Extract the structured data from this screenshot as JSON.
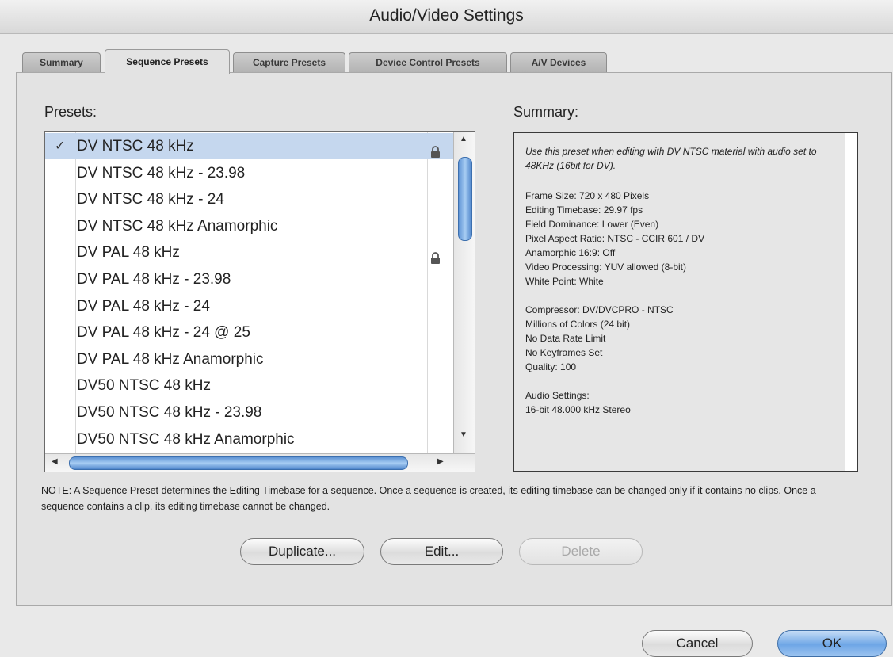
{
  "window": {
    "title": "Audio/Video Settings"
  },
  "tabs": [
    {
      "label": "Summary",
      "active": false
    },
    {
      "label": "Sequence Presets",
      "active": true
    },
    {
      "label": "Capture Presets",
      "active": false
    },
    {
      "label": "Device Control Presets",
      "active": false
    },
    {
      "label": "A/V Devices",
      "active": false
    }
  ],
  "presets": {
    "label": "Presets:",
    "check_glyph": "✓",
    "items": [
      {
        "label": "DV NTSC 48 kHz",
        "selected": true,
        "checked": true,
        "locked": true
      },
      {
        "label": "DV NTSC 48 kHz - 23.98",
        "selected": false,
        "checked": false,
        "locked": false
      },
      {
        "label": "DV NTSC 48 kHz - 24",
        "selected": false,
        "checked": false,
        "locked": false
      },
      {
        "label": "DV NTSC 48 kHz Anamorphic",
        "selected": false,
        "checked": false,
        "locked": false
      },
      {
        "label": "DV PAL 48 kHz",
        "selected": false,
        "checked": false,
        "locked": true
      },
      {
        "label": "DV PAL 48 kHz - 23.98",
        "selected": false,
        "checked": false,
        "locked": false
      },
      {
        "label": "DV PAL 48 kHz - 24",
        "selected": false,
        "checked": false,
        "locked": false
      },
      {
        "label": "DV PAL 48 kHz - 24 @ 25",
        "selected": false,
        "checked": false,
        "locked": false
      },
      {
        "label": "DV PAL 48 kHz Anamorphic",
        "selected": false,
        "checked": false,
        "locked": false
      },
      {
        "label": "DV50 NTSC 48 kHz",
        "selected": false,
        "checked": false,
        "locked": false
      },
      {
        "label": "DV50 NTSC 48 kHz - 23.98",
        "selected": false,
        "checked": false,
        "locked": false
      },
      {
        "label": "DV50 NTSC 48 kHz Anamorphic",
        "selected": false,
        "checked": false,
        "locked": false
      }
    ]
  },
  "summary": {
    "label": "Summary:",
    "description": "Use this preset when editing with DV NTSC material with audio set to 48KHz (16bit for DV).",
    "video_lines": [
      "Frame Size: 720 x 480 Pixels",
      "Editing Timebase: 29.97 fps",
      "Field Dominance: Lower (Even)",
      "Pixel Aspect Ratio: NTSC - CCIR 601 / DV",
      "Anamorphic 16:9: Off",
      "Video Processing: YUV allowed (8-bit)",
      "White Point: White"
    ],
    "compressor_lines": [
      "Compressor: DV/DVCPRO - NTSC",
      "Millions of Colors (24 bit)",
      "No Data Rate Limit",
      "No Keyframes Set",
      "Quality: 100"
    ],
    "audio_lines": [
      "Audio Settings:",
      "16-bit 48.000 kHz Stereo"
    ]
  },
  "note": "NOTE: A Sequence Preset determines the Editing Timebase for a sequence. Once a sequence is created, its editing timebase can be changed only if it contains no clips. Once a sequence contains a clip, its editing timebase cannot be changed.",
  "buttons": {
    "duplicate": "Duplicate...",
    "edit": "Edit...",
    "delete": "Delete",
    "cancel": "Cancel",
    "ok": "OK"
  },
  "colors": {
    "selection": "#c5d7ee",
    "default_button": "#6ea6e6",
    "scroll_thumb": "#5e93d4"
  }
}
